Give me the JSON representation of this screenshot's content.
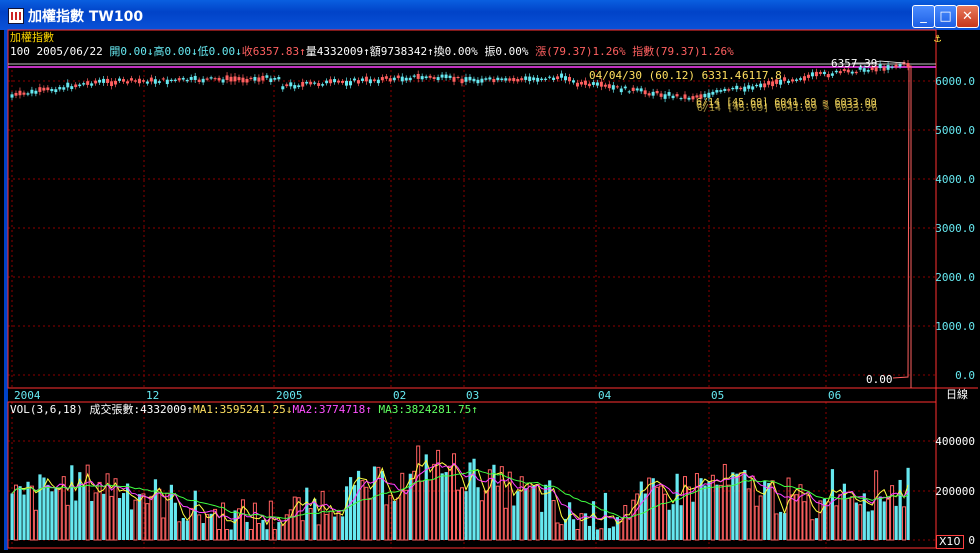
{
  "window": {
    "title": "加權指數 TW100",
    "minimize": "_",
    "maximize": "□",
    "close": "✕"
  },
  "info": {
    "name": "加權指數",
    "code": "100",
    "date": "2005/06/22",
    "open": "開0.00↓",
    "high": "高0.00↓",
    "low": "低0.00↓",
    "close": "收6357.83↑",
    "volume": "量4332009↑",
    "amount": "額9738342↑",
    "turnover": "換0.00%",
    "amplitude": "振0.00%",
    "change": "漲(79.37)1.26%",
    "index_change": "指數(79.37)1.26%"
  },
  "annotations": {
    "peak_label": "6357.39",
    "low_label": "0.00",
    "mid_label_1": "04/04/30 (60.12) 6331.4",
    "mid_label_2": "6117.8",
    "mid_label_3": "6/14 [45.69] 6041.69 ≈ 6033.00",
    "mid_label_4": "6/13 [40.00] 6039.80 ≈ 6033.00",
    "mid_label_5": "6/14 [45.69] 6041.69 ≈ 6035.26"
  },
  "price_axis": {
    "ticks": [
      "6000.0",
      "5000.0",
      "4000.0",
      "3000.0",
      "2000.0",
      "1000.0",
      "0.0"
    ]
  },
  "time_axis": {
    "ticks": [
      "2004",
      "12",
      "2005",
      "02",
      "03",
      "04",
      "05",
      "06"
    ],
    "scale_button": "日線"
  },
  "volume": {
    "label": "VOL(3,6,18)",
    "total": "成交張數:4332009↑",
    "ma1": "MA1:3595241.25↓",
    "ma2": "MA2:3774718↑",
    "ma3": "MA3:3824281.75↑",
    "axis_ticks": [
      "400000",
      "200000",
      "0"
    ],
    "multiplier": "X10"
  },
  "colors": {
    "up": "#ff6060",
    "down": "#66e8f0",
    "ma1": "#ffff40",
    "ma2": "#ff40ff",
    "ma3": "#40ff40",
    "grid": "#8b0000",
    "frame": "#ff3030"
  },
  "icons": {
    "anchor": "anchor-icon",
    "app": "chart-app-icon"
  }
}
